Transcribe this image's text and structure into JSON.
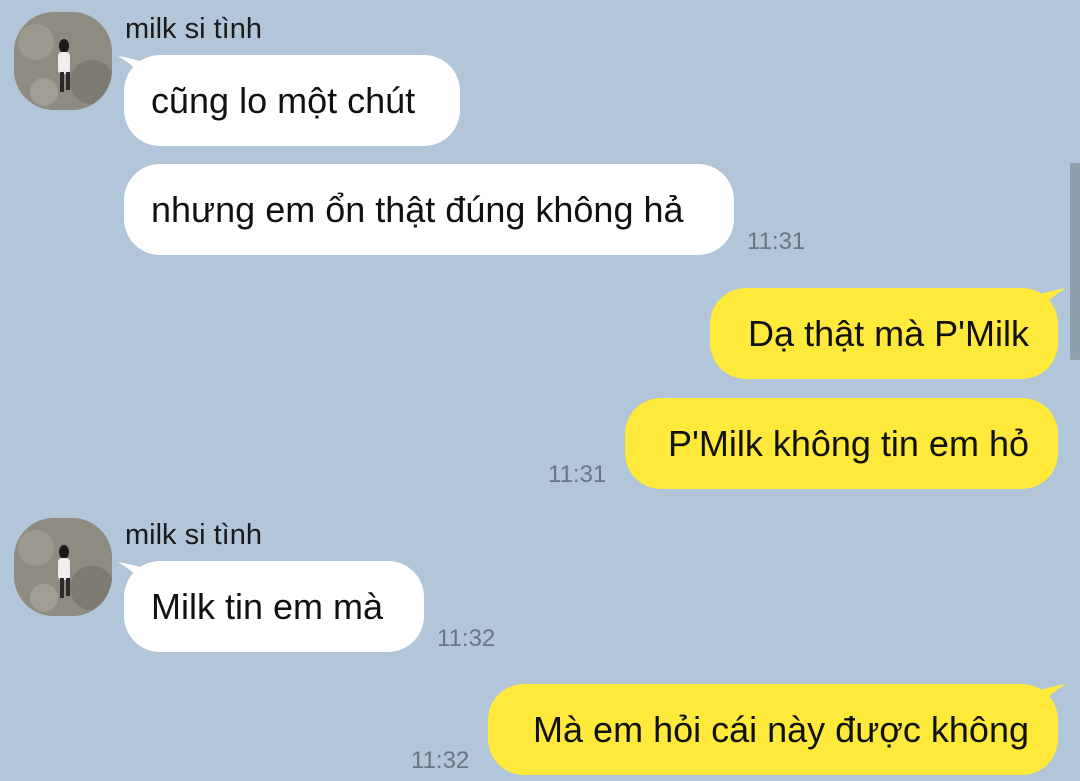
{
  "contact": {
    "name": "milk si tình",
    "avatar_icon": "profile-photo-person-walking"
  },
  "colors": {
    "background": "#b2c6d9",
    "incoming_bubble": "#ffffff",
    "outgoing_bubble": "#ffe93a"
  },
  "messages": [
    {
      "direction": "incoming",
      "sender": "milk si tình",
      "text": "cũng lo một chút",
      "time": ""
    },
    {
      "direction": "incoming",
      "sender": "",
      "text": "nhưng em ổn thật đúng không hả",
      "time": "11:31"
    },
    {
      "direction": "outgoing",
      "text": "Dạ thật mà P'Milk",
      "time": ""
    },
    {
      "direction": "outgoing",
      "text": "P'Milk không tin em hỏ",
      "time": "11:31"
    },
    {
      "direction": "incoming",
      "sender": "milk si tình",
      "text": "Milk tin em mà",
      "time": "11:32"
    },
    {
      "direction": "outgoing",
      "text": "Mà em hỏi cái này được không",
      "time": "11:32"
    }
  ]
}
